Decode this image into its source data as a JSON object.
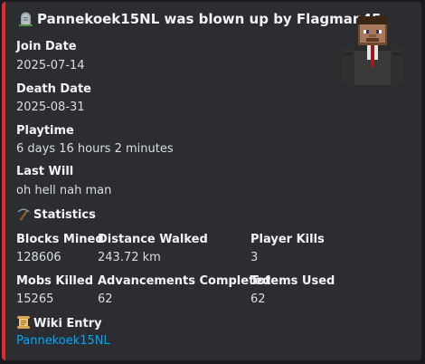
{
  "embed": {
    "accent_color": "#e02b2b",
    "title": "Pannekoek15NL was blown up by Flagman45",
    "title_icon": "tombstone-icon",
    "avatar": "minecraft-player-head-avatar"
  },
  "fields": {
    "join_date": {
      "name": "Join Date",
      "value": "2025-07-14"
    },
    "death_date": {
      "name": "Death Date",
      "value": "2025-08-31"
    },
    "playtime": {
      "name": "Playtime",
      "value": "6 days 16 hours 2 minutes"
    },
    "last_will": {
      "name": "Last Will",
      "value": "oh hell nah man"
    }
  },
  "statistics": {
    "heading": "Statistics",
    "icon": "pickaxe-icon",
    "blocks_mined": {
      "name": "Blocks Mined",
      "value": "128606"
    },
    "distance_walked": {
      "name": "Distance Walked",
      "value": "243.72 km"
    },
    "player_kills": {
      "name": "Player Kills",
      "value": "3"
    },
    "mobs_killed": {
      "name": "Mobs Killed",
      "value": "15265"
    },
    "advancements": {
      "name": "Advancements Completed",
      "value": "62"
    },
    "totems_used": {
      "name": "Totems Used",
      "value": "62"
    }
  },
  "wiki": {
    "heading": "Wiki Entry",
    "icon": "scroll-icon",
    "link": "Pannekoek15NL",
    "link_color": "#00a8fc"
  }
}
